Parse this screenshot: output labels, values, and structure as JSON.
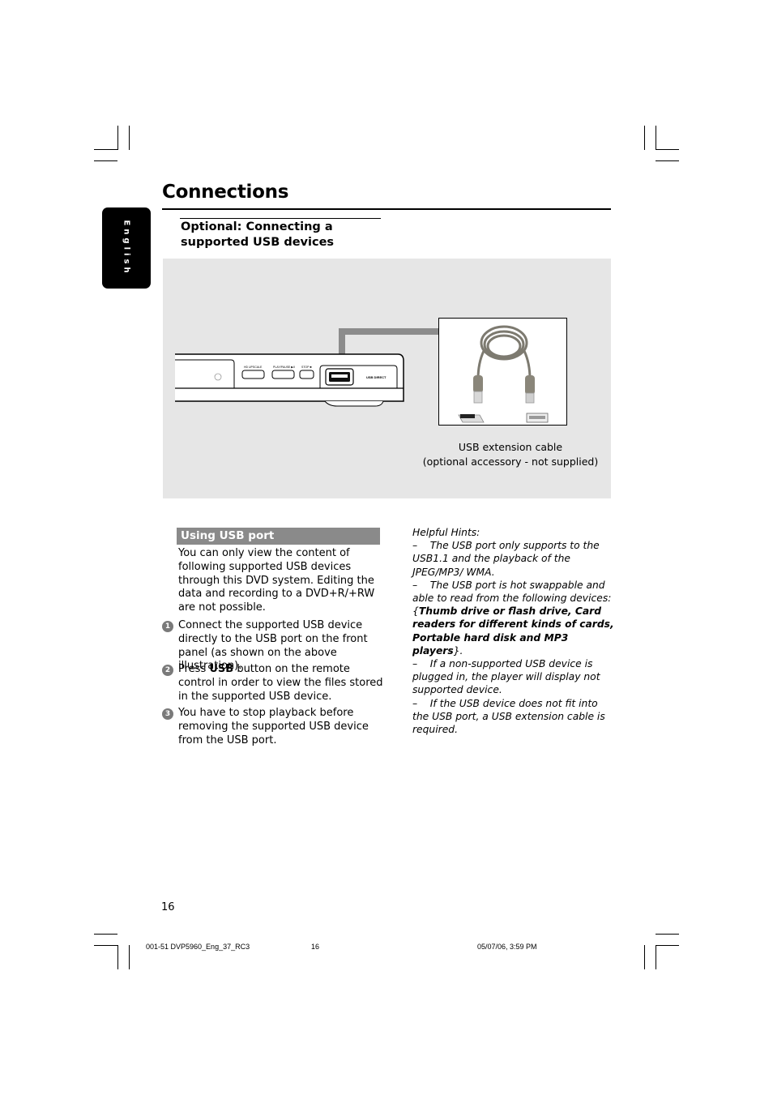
{
  "header": {
    "title": "Connections",
    "language_tab": "English"
  },
  "section": {
    "subheading_line1": "Optional: Connecting a",
    "subheading_line2": "supported USB devices"
  },
  "figure": {
    "device_buttons": [
      "HD UPSCALE",
      "PLAY/PAUSE ▶II",
      "STOP ■"
    ],
    "usb_label": "USB DIRECT",
    "caption_line1": "USB extension cable",
    "caption_line2": "(optional accessory - not supplied)",
    "colors": {
      "background": "#e6e6e6",
      "arrow": "#8c8c8c"
    }
  },
  "using_usb": {
    "heading": "Using USB port",
    "intro": "You can only view the content of following supported USB devices through this DVD system. Editing the data and recording to a DVD+R/+RW are not possible.",
    "steps": [
      {
        "num": "1",
        "text": "Connect the supported USB device directly to the USB port on the front panel (as shown on the above illustration)."
      },
      {
        "num": "2",
        "pre": "Press ",
        "bold": "USB",
        "post": " button on the remote control in order to view the files stored in the supported USB device."
      },
      {
        "num": "3",
        "text": "You have to stop playback before removing the supported USB device from the USB port."
      }
    ]
  },
  "hints": {
    "title": "Helpful Hints:",
    "items": [
      {
        "text": "The USB port only supports to the USB1.1 and the playback of the JPEG/MP3/ WMA."
      },
      {
        "pre": "The USB port is hot swappable and able to read from the following devices: {",
        "bold": "Thumb drive or flash drive, Card readers for different kinds of cards, Portable hard disk and MP3 players",
        "post": "}."
      },
      {
        "text": "If a non-supported USB device is plugged in, the player will display not supported device."
      },
      {
        "text": "If the USB device does not fit into the USB port, a USB extension cable is required."
      }
    ]
  },
  "footer": {
    "page_number": "16",
    "file_name": "001-51 DVP5960_Eng_37_RC3",
    "file_page": "16",
    "timestamp": "05/07/06, 3:59 PM"
  }
}
